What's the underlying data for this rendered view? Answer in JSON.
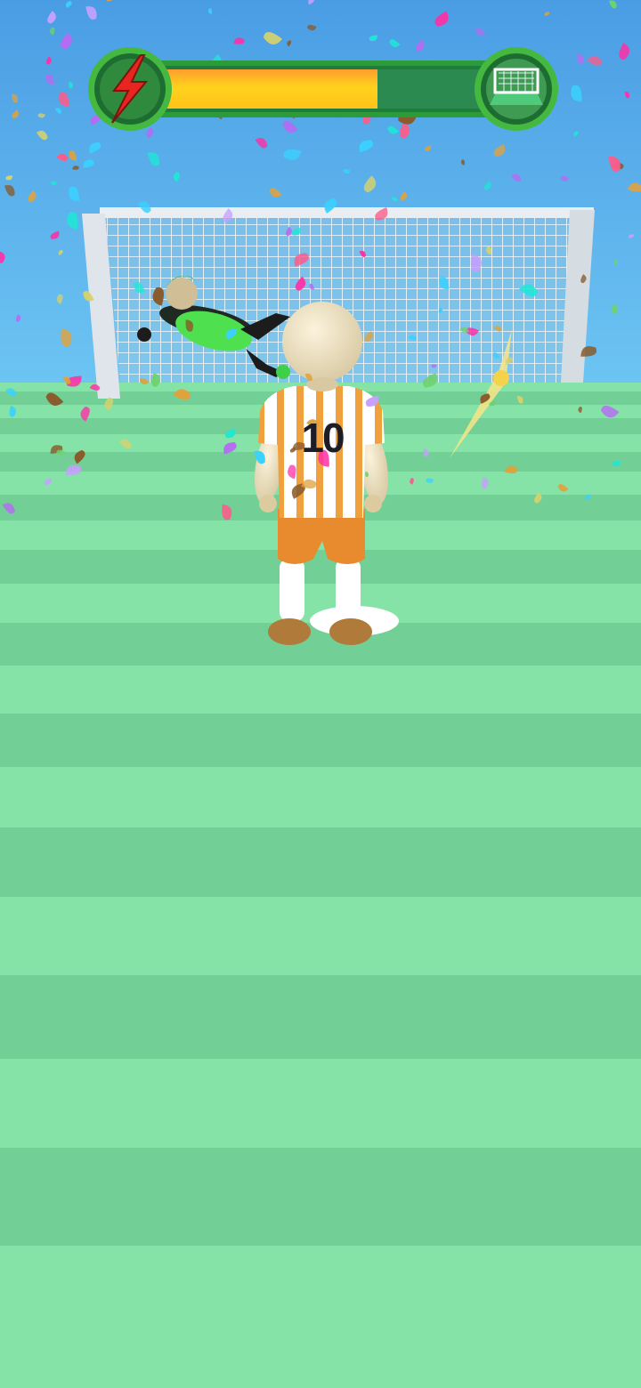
{
  "hud": {
    "power_icon": "lightning-bolt-icon",
    "goal_icon": "soccer-goal-icon",
    "progress": 0.6
  },
  "player": {
    "shirt_number": "10"
  },
  "colors": {
    "sky": "#4fa3e6",
    "pitch_light": "#86e3a8",
    "pitch_dark": "#72cf95",
    "hud_green": "#2c9c3a",
    "progress_fill": "#ffc81e",
    "progress_track": "#2a8a4f",
    "bolt": "#e8261f",
    "shirt_stripe": "#f0a03c",
    "shorts": "#e88a2e",
    "skin": "#efe3c4"
  },
  "confetti_colors": [
    "#ff2fa6",
    "#1ee7d7",
    "#b46cf2",
    "#6fd36a",
    "#8a5a2a",
    "#d6d26b",
    "#ff5b8a",
    "#3ad1ff",
    "#c7a0ff",
    "#e0a23c"
  ]
}
